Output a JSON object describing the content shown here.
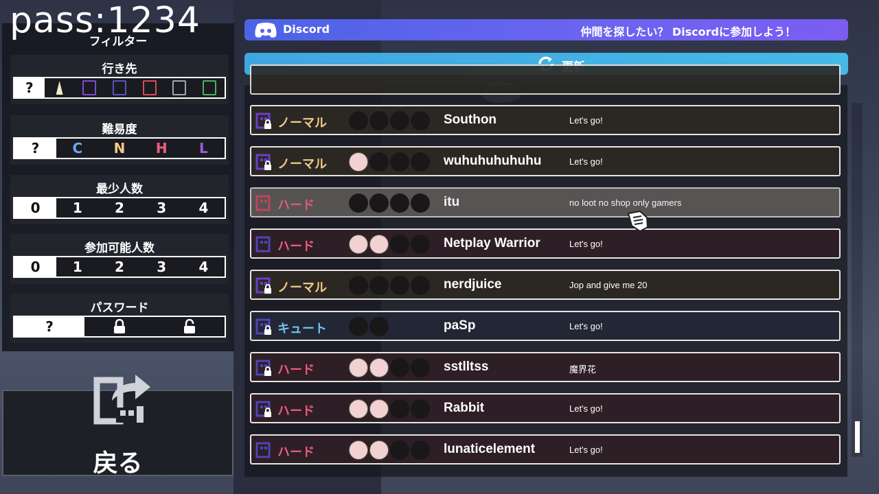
{
  "overlay_text": "pass:1234",
  "filter": {
    "title": "フィルター",
    "destination": {
      "label": "行き先"
    },
    "difficulty": {
      "label": "難易度",
      "options": [
        "?",
        "C",
        "N",
        "H",
        "L"
      ]
    },
    "min_players": {
      "label": "最少人数",
      "options": [
        "0",
        "1",
        "2",
        "3",
        "4"
      ]
    },
    "joinable_players": {
      "label": "参加可能人数",
      "options": [
        "0",
        "1",
        "2",
        "3",
        "4"
      ]
    },
    "password": {
      "label": "パスワード",
      "options": [
        "?"
      ]
    }
  },
  "back": {
    "label": "戻る"
  },
  "discord": {
    "name": "Discord",
    "message": "仲間を探したい？ Discordに参加しよう！"
  },
  "refresh": {
    "label": "更新"
  },
  "colors": {
    "normal": "#f4cc86",
    "hard": "#f15c7f",
    "cute": "#6fc3ef",
    "discord": "#5865f2",
    "refresh": "#42b0e3"
  },
  "rooms": [
    {
      "difficulty": "ノーマル",
      "kind": "normal",
      "stage": "purple-grid",
      "locked": true,
      "players": 0,
      "name": "Southon",
      "message": "Let's go!"
    },
    {
      "difficulty": "ノーマル",
      "kind": "normal",
      "stage": "purple-grid",
      "locked": true,
      "players": 1,
      "name": "wuhuhuhuhuhu",
      "message": "Let's go!"
    },
    {
      "difficulty": "ハード",
      "kind": "hard",
      "stage": "red-door",
      "locked": false,
      "players": 0,
      "name": "itu",
      "message": "no loot no shop only gamers"
    },
    {
      "difficulty": "ハード",
      "kind": "hard",
      "stage": "blue-machine",
      "locked": false,
      "players": 2,
      "name": "Netplay Warrior",
      "message": "Let's go!"
    },
    {
      "difficulty": "ノーマル",
      "kind": "normal",
      "stage": "purple-grid",
      "locked": true,
      "players": 0,
      "name": "nerdjuice",
      "message": "Jop and give me 20"
    },
    {
      "difficulty": "キュート",
      "kind": "cute",
      "stage": "blue-machine",
      "locked": true,
      "players": 0,
      "name": "paSp",
      "message": "Let's go!"
    },
    {
      "difficulty": "ハード",
      "kind": "hard",
      "stage": "blue-machine",
      "locked": true,
      "players": 2,
      "name": "sstlltss",
      "message": "魔界花"
    },
    {
      "difficulty": "ハード",
      "kind": "hard",
      "stage": "blue-machine",
      "locked": true,
      "players": 2,
      "name": "Rabbit",
      "message": "Let's go!"
    },
    {
      "difficulty": "ハード",
      "kind": "hard",
      "stage": "blue-machine",
      "locked": false,
      "players": 2,
      "name": "lunaticelement",
      "message": "Let's go!"
    }
  ]
}
